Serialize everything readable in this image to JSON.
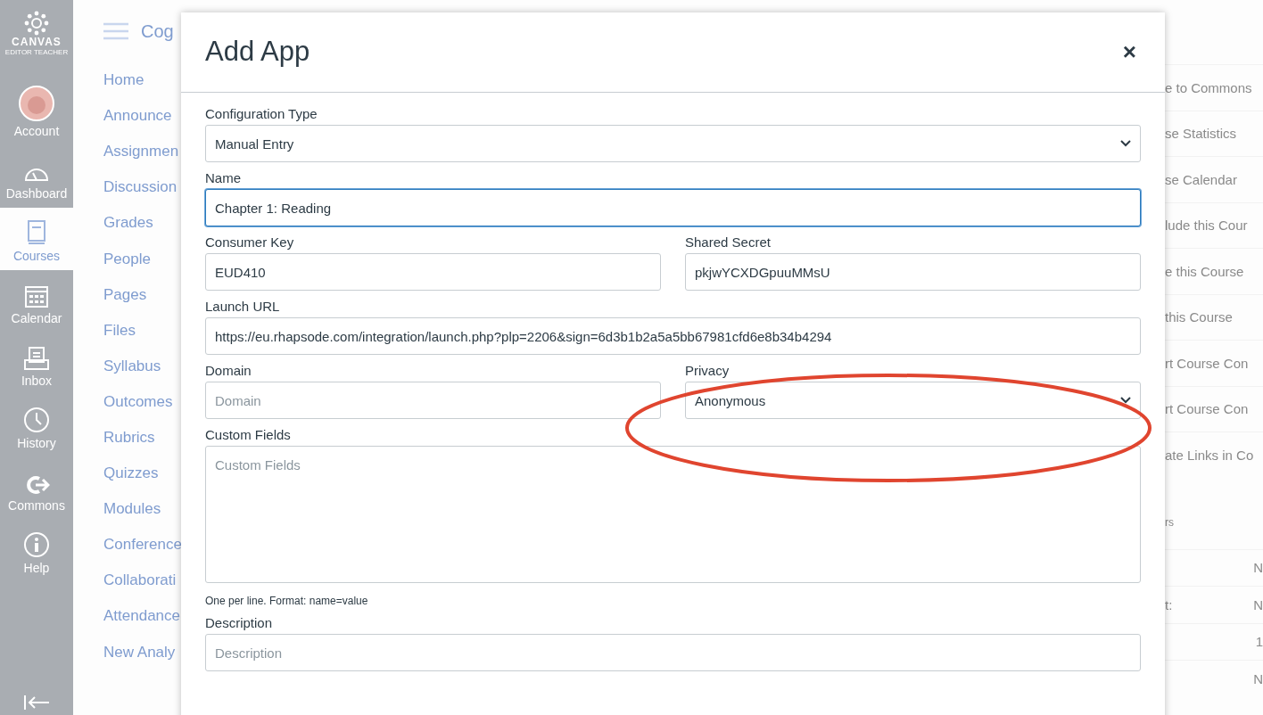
{
  "global_nav": {
    "logo": {
      "title": "CANVAS",
      "subtitle": "EDITOR TEACHER"
    },
    "items": [
      {
        "label": "Account",
        "selected": false
      },
      {
        "label": "Dashboard",
        "selected": false
      },
      {
        "label": "Courses",
        "selected": true
      },
      {
        "label": "Calendar",
        "selected": false
      },
      {
        "label": "Inbox",
        "selected": false
      },
      {
        "label": "History",
        "selected": false
      },
      {
        "label": "Commons",
        "selected": false
      },
      {
        "label": "Help",
        "selected": false
      }
    ]
  },
  "breadcrumb": "Cog",
  "course_nav": [
    "Home",
    "Announce",
    "Assignmen",
    "Discussion",
    "Grades",
    "People",
    "Pages",
    "Files",
    "Syllabus",
    "Outcomes",
    "Rubrics",
    "Quizzes",
    "Modules",
    "Conference",
    "Collaborati",
    "Attendance",
    "New Analy"
  ],
  "sidebar_links": [
    "e to Commons",
    "se Statistics",
    "se Calendar",
    "lude this Cour",
    "e this Course",
    "this Course",
    "rt Course Con",
    "rt Course Con",
    "ate Links in Co"
  ],
  "sidebar_section": {
    "heading": "rs",
    "rows": [
      {
        "value": "N"
      },
      {
        "label": "t:",
        "value": "N"
      },
      {
        "value": "1"
      },
      {
        "value": "N"
      }
    ]
  },
  "dialog": {
    "title": "Add App",
    "close": "×",
    "rows": [
      [
        {
          "kind": "select",
          "label": "Configuration Type",
          "value": "Manual Entry"
        }
      ],
      [
        {
          "kind": "input",
          "label": "Name",
          "value": "Chapter 1: Reading",
          "focused": true
        }
      ],
      [
        {
          "kind": "input",
          "label": "Consumer Key",
          "value": "EUD410"
        },
        {
          "kind": "input",
          "label": "Shared Secret",
          "value": "pkjwYCXDGpuuMMsU"
        }
      ],
      [
        {
          "kind": "input",
          "label": "Launch URL",
          "value": "https://eu.rhapsode.com/integration/launch.php?plp=2206&sign=6d3b1b2a5a5bb67981cfd6e8b34b4294"
        }
      ],
      [
        {
          "kind": "input",
          "label": "Domain",
          "placeholder": "Domain"
        },
        {
          "kind": "select",
          "label": "Privacy",
          "value": "Anonymous",
          "highlighted": true
        }
      ],
      [
        {
          "kind": "textarea",
          "label": "Custom Fields",
          "placeholder": "Custom Fields",
          "hint": "One per line. Format: name=value"
        }
      ],
      [
        {
          "kind": "input",
          "label": "Description",
          "placeholder": "Description"
        }
      ]
    ]
  }
}
